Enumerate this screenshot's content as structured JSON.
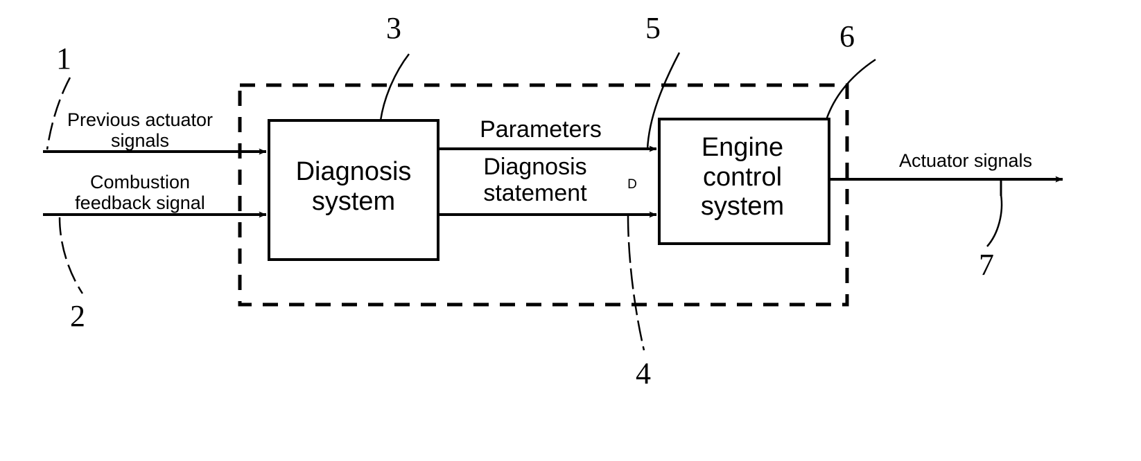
{
  "figure": {
    "type": "engineering-block-diagram",
    "background_color": "#ffffff",
    "line_color": "#000000"
  },
  "inputs": {
    "previous_actuator_signals": "Previous actuator\nsignals",
    "combustion_feedback_signal": "Combustion\nfeedback signal"
  },
  "blocks": {
    "diagnosis_system": "Diagnosis\nsystem",
    "engine_control_system": "Engine\ncontrol\nsystem"
  },
  "flows": {
    "parameters": "Parameters",
    "diagnosis_statement": "Diagnosis\nstatement",
    "diagnosis_statement_symbol": "D"
  },
  "outputs": {
    "actuator_signals": "Actuator signals"
  },
  "reference_numerals": {
    "n1": "1",
    "n2": "2",
    "n3": "3",
    "n4": "4",
    "n5": "5",
    "n6": "6",
    "n7": "7"
  }
}
